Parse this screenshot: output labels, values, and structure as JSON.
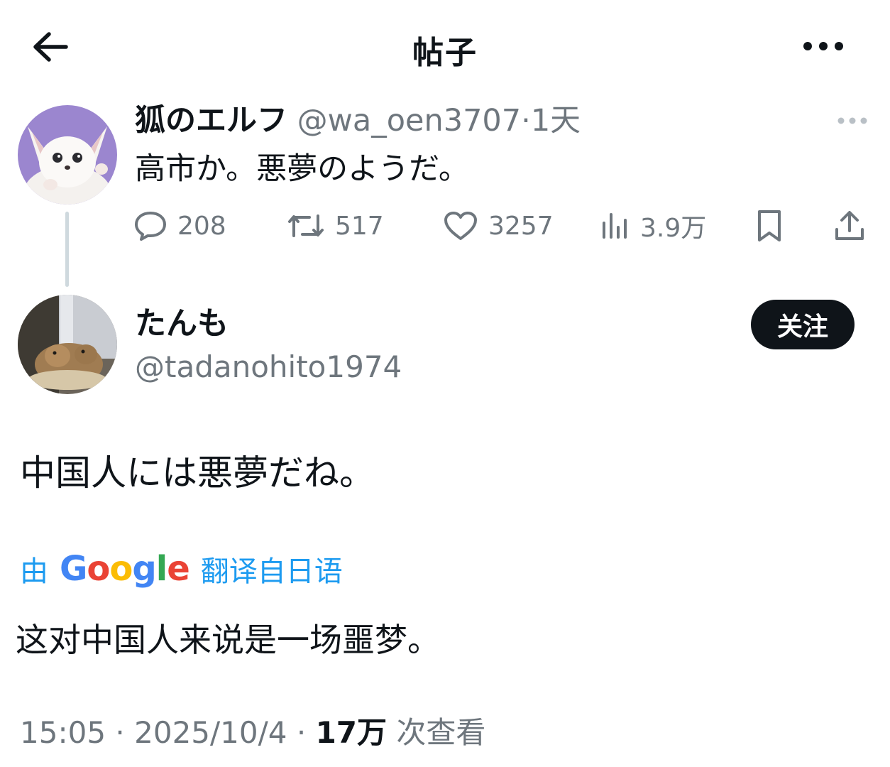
{
  "header": {
    "title": "帖子",
    "back_icon": "arrow-left-icon",
    "more_icon": "more-horizontal-icon"
  },
  "quoted_post": {
    "display_name": "狐のエルフ",
    "handle": "@wa_oen3707",
    "separator": "·",
    "time": "1天",
    "text": "高市か。悪夢のようだ。",
    "replies": "208",
    "reposts": "517",
    "likes": "3257",
    "views": "3.9万"
  },
  "main_post": {
    "display_name": "たんも",
    "handle": "@tadanohito1974",
    "follow_label": "关注",
    "text": "中国人には悪夢だね。",
    "translated_by_prefix": "由",
    "translated_by_logo": "Google",
    "translated_by_suffix": "翻译自日语",
    "translated_text": "这对中国人来说是一场噩梦。",
    "time": "15:05",
    "date": "2025/10/4",
    "separator": "·",
    "views_count": "17万",
    "views_label": "次查看"
  },
  "colors": {
    "text_primary": "#0f1419",
    "text_secondary": "#6e767d",
    "link": "#1d9bf0",
    "button_bg": "#0f1419",
    "thread_line": "#cfd9de"
  }
}
